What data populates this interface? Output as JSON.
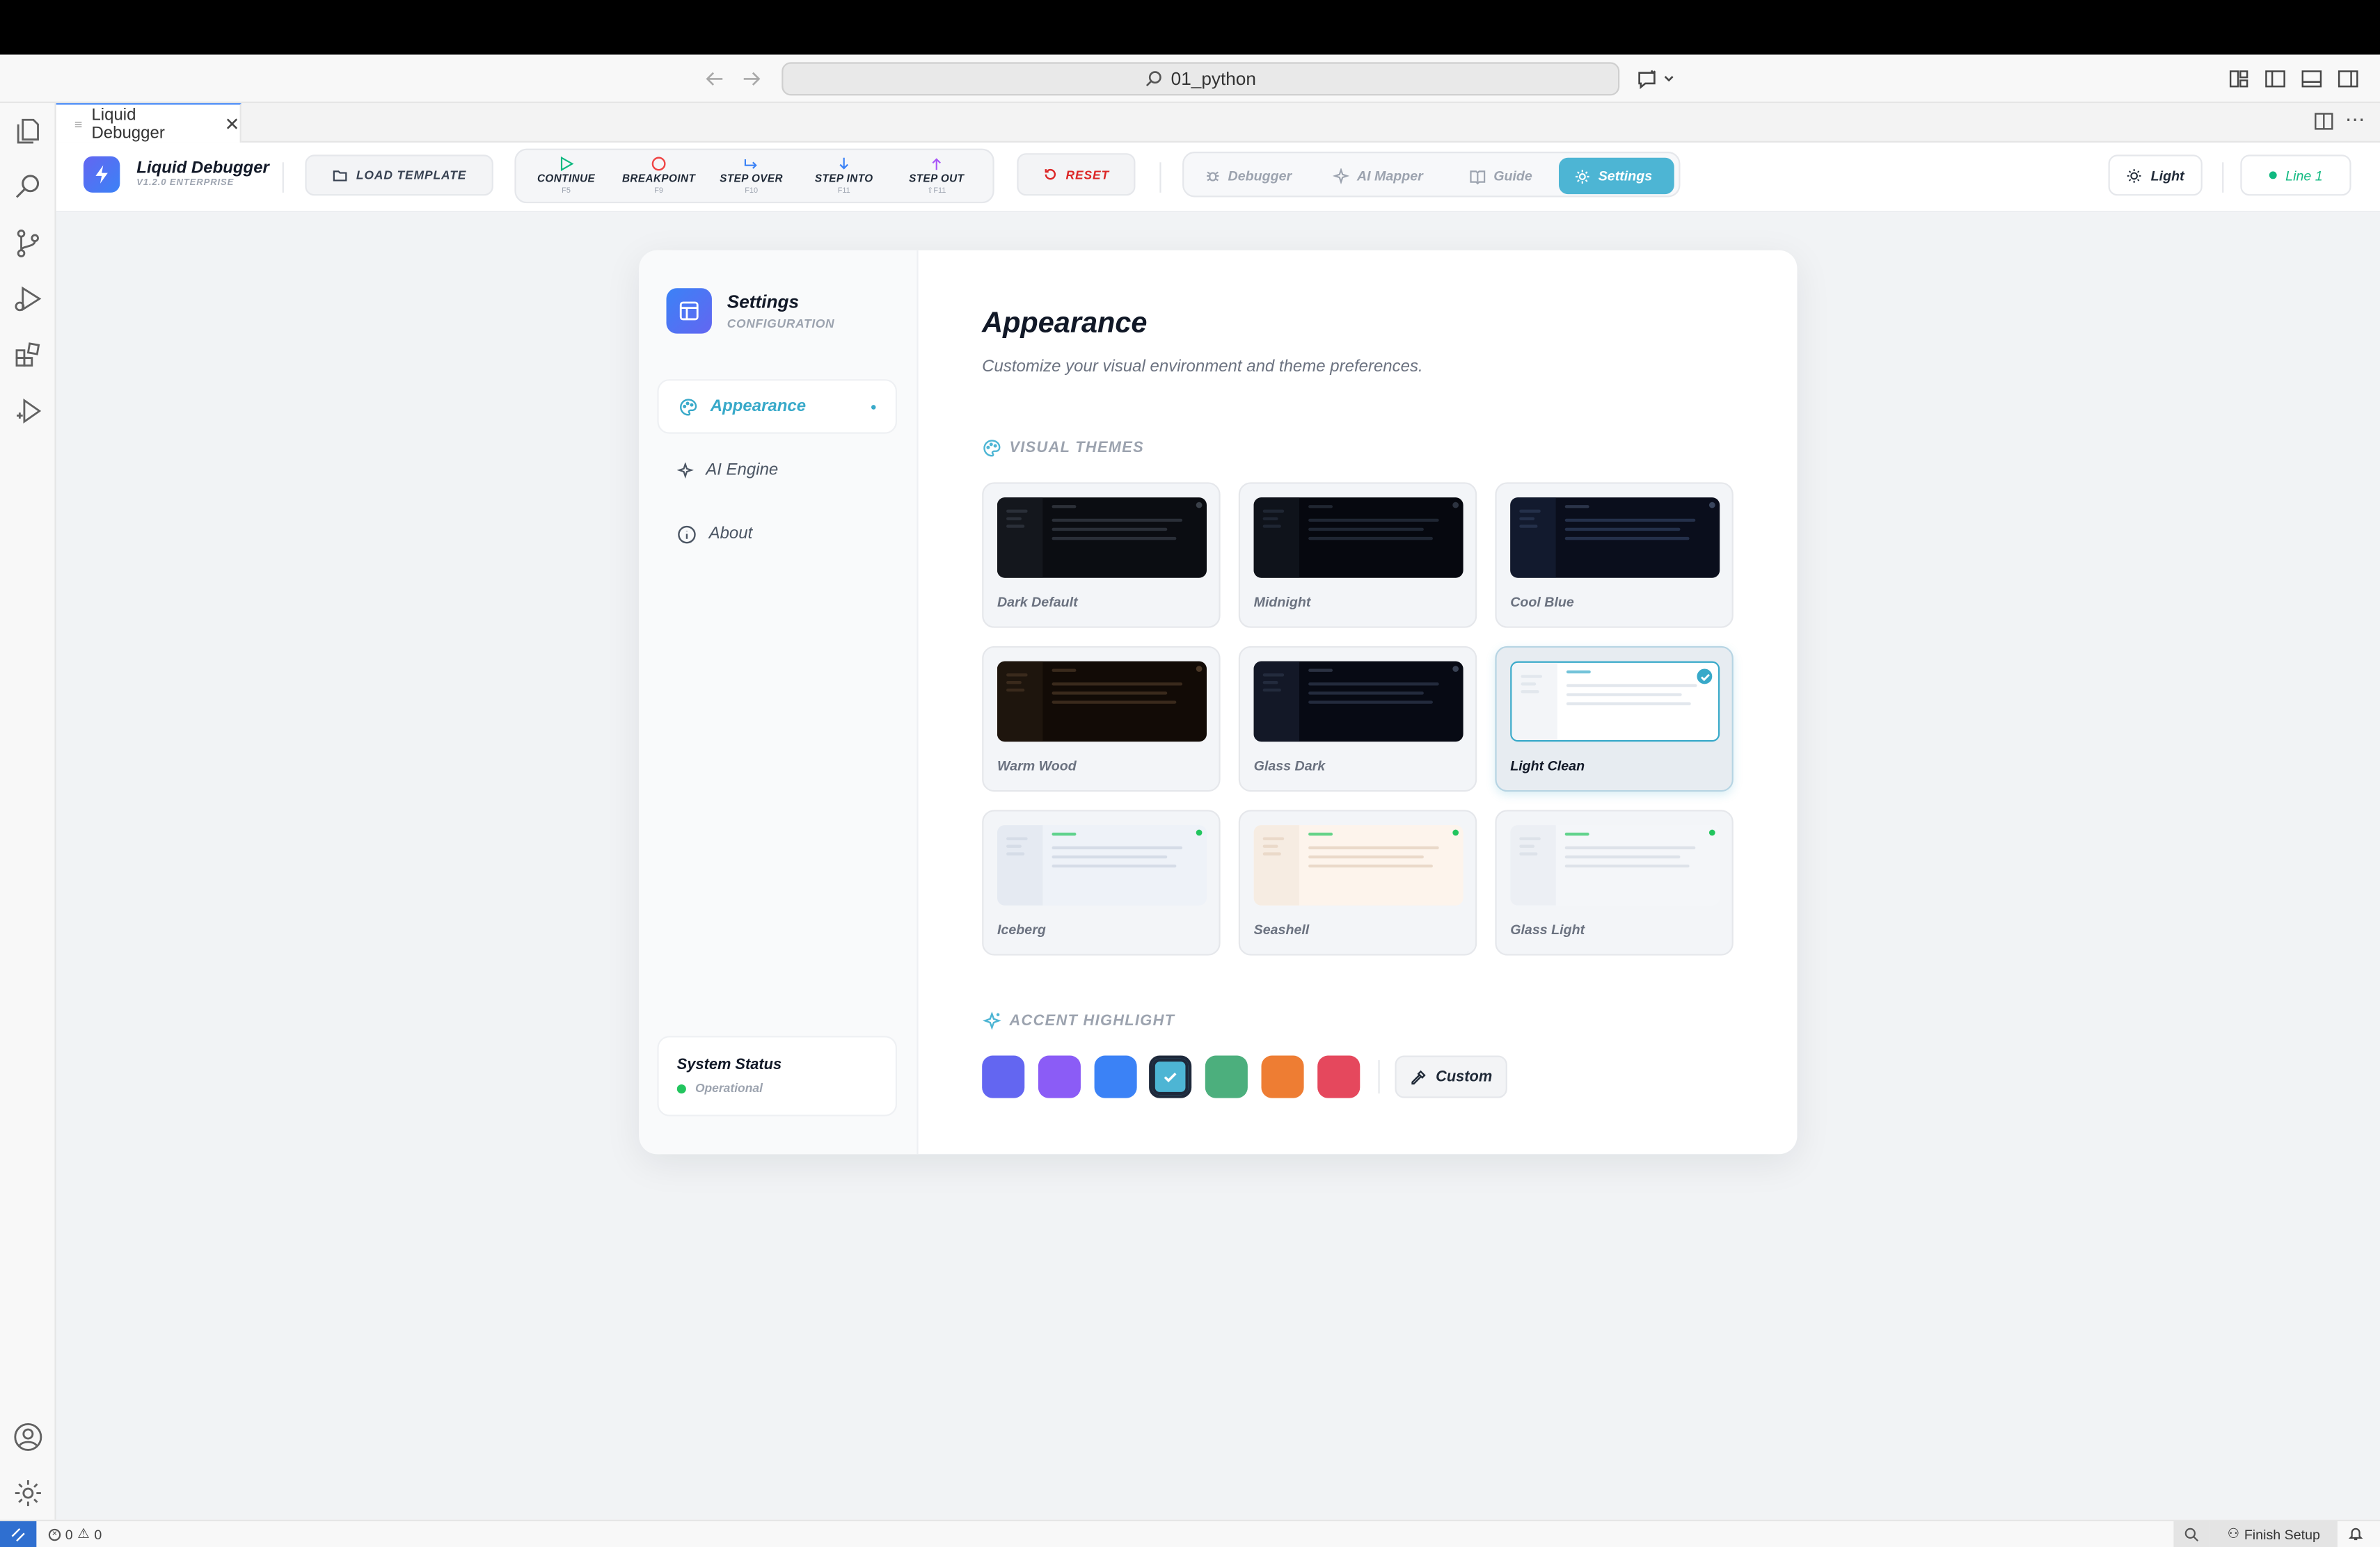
{
  "window": {
    "search_text": "01_python"
  },
  "tab": {
    "title": "Liquid Debugger"
  },
  "header": {
    "brand_name": "Liquid Debugger",
    "brand_version": "V1.2.0 ENTERPRISE",
    "load_label": "LOAD TEMPLATE",
    "controls": [
      {
        "label": "CONTINUE",
        "key": "F5",
        "icon": "play-icon",
        "color": "#10b981"
      },
      {
        "label": "BREAKPOINT",
        "key": "F9",
        "icon": "breakpoint-icon",
        "color": "#ef4444"
      },
      {
        "label": "STEP OVER",
        "key": "F10",
        "icon": "step-over-icon",
        "color": "#3b82f6"
      },
      {
        "label": "STEP INTO",
        "key": "F11",
        "icon": "step-into-icon",
        "color": "#3b82f6"
      },
      {
        "label": "STEP OUT",
        "key": "⇧F11",
        "icon": "step-out-icon",
        "color": "#a855f7"
      }
    ],
    "reset_label": "RESET",
    "nav_tabs": [
      {
        "label": "Debugger",
        "icon": "bug-icon",
        "active": false
      },
      {
        "label": "AI Mapper",
        "icon": "sparkle-icon",
        "active": false
      },
      {
        "label": "Guide",
        "icon": "book-icon",
        "active": false
      },
      {
        "label": "Settings",
        "icon": "gear-icon",
        "active": true
      }
    ],
    "theme_label": "Light",
    "line_label": "Line 1"
  },
  "settings": {
    "title": "Settings",
    "subtitle": "CONFIGURATION",
    "nav": [
      {
        "label": "Appearance",
        "icon": "palette-icon",
        "active": true
      },
      {
        "label": "AI Engine",
        "icon": "sparkle-icon",
        "active": false
      },
      {
        "label": "About",
        "icon": "info-icon",
        "active": false
      }
    ],
    "status_title": "System Status",
    "status_text": "Operational"
  },
  "appearance": {
    "title": "Appearance",
    "description": "Customize your visual environment and theme preferences.",
    "themes_label": "VISUAL THEMES",
    "themes": [
      {
        "name": "Dark Default",
        "bg": "#0b0d12",
        "side": "#14171d",
        "line": "#2a2f38",
        "dot": "#3a4049",
        "selected": false
      },
      {
        "name": "Midnight",
        "bg": "#06080f",
        "side": "#0f131b",
        "line": "#1f2633",
        "dot": "#2c3340",
        "selected": false
      },
      {
        "name": "Cool Blue",
        "bg": "#0a0e1c",
        "side": "#121a2e",
        "line": "#24304a",
        "dot": "#39455d",
        "selected": false
      },
      {
        "name": "Warm Wood",
        "bg": "#120b06",
        "side": "#1e150d",
        "line": "#3a2a1c",
        "dot": "#4b3827",
        "selected": false
      },
      {
        "name": "Glass Dark",
        "bg": "#070a14",
        "side": "#131827",
        "line": "#232b3d",
        "dot": "#3a4355",
        "selected": false
      },
      {
        "name": "Light Clean",
        "bg": "#ffffff",
        "side": "#f3f5f8",
        "line": "#e2e7ed",
        "dot": "#38a9c9",
        "selected": true
      },
      {
        "name": "Iceberg",
        "bg": "#eef2f8",
        "side": "#e5eaf2",
        "line": "#d5dce7",
        "dot": "#22c55e",
        "selected": false
      },
      {
        "name": "Seashell",
        "bg": "#fdf4ec",
        "side": "#f6ece2",
        "line": "#ead9c9",
        "dot": "#22c55e",
        "selected": false
      },
      {
        "name": "Glass Light",
        "bg": "#f4f6f9",
        "side": "#eceff4",
        "line": "#dde2e9",
        "dot": "#22c55e",
        "selected": false
      }
    ],
    "accent_label": "ACCENT HIGHLIGHT",
    "accents": [
      "#6366f1",
      "#8b5cf6",
      "#3b82f6",
      "#4db5d4",
      "#4caf7d",
      "#ee7d33",
      "#e5485d"
    ],
    "selected_accent": 3,
    "custom_label": "Custom"
  },
  "statusbar": {
    "errors": "0",
    "warnings": "0",
    "finish_label": "Finish Setup"
  }
}
